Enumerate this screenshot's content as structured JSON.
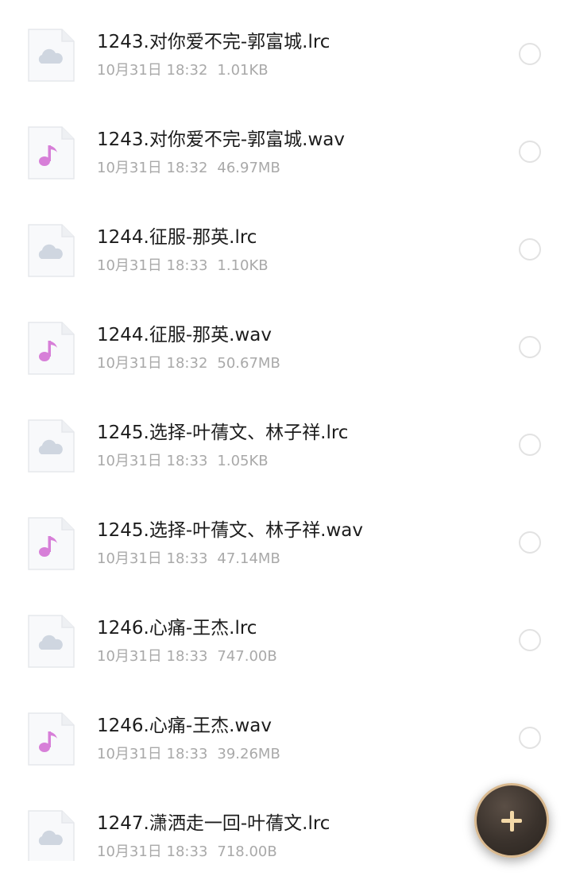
{
  "files": [
    {
      "name": "1243.对你爱不完-郭富城.lrc",
      "date": "10月31日 18:32",
      "size": "1.01KB",
      "icon": "cloud-file-icon"
    },
    {
      "name": "1243.对你爱不完-郭富城.wav",
      "date": "10月31日 18:32",
      "size": "46.97MB",
      "icon": "music-file-icon"
    },
    {
      "name": "1244.征服-那英.lrc",
      "date": "10月31日 18:33",
      "size": "1.10KB",
      "icon": "cloud-file-icon"
    },
    {
      "name": "1244.征服-那英.wav",
      "date": "10月31日 18:32",
      "size": "50.67MB",
      "icon": "music-file-icon"
    },
    {
      "name": "1245.选择-叶蒨文、林子祥.lrc",
      "date": "10月31日 18:33",
      "size": "1.05KB",
      "icon": "cloud-file-icon"
    },
    {
      "name": "1245.选择-叶蒨文、林子祥.wav",
      "date": "10月31日 18:33",
      "size": "47.14MB",
      "icon": "music-file-icon"
    },
    {
      "name": "1246.心痛-王杰.lrc",
      "date": "10月31日 18:33",
      "size": "747.00B",
      "icon": "cloud-file-icon"
    },
    {
      "name": "1246.心痛-王杰.wav",
      "date": "10月31日 18:33",
      "size": "39.26MB",
      "icon": "music-file-icon"
    },
    {
      "name": "1247.潇洒走一回-叶蒨文.lrc",
      "date": "10月31日 18:33",
      "size": "718.00B",
      "icon": "cloud-file-icon"
    }
  ],
  "colors": {
    "music_accent": "#d77fd8",
    "cloud_icon": "#cfd6e0",
    "fab_ring": "#d9b98f",
    "fab_body": "#3a322c"
  },
  "fab": {
    "icon": "plus-icon"
  }
}
